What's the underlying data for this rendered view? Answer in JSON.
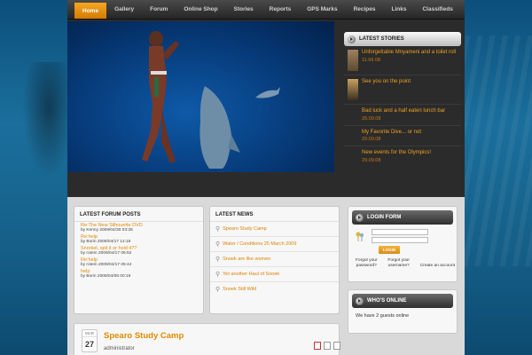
{
  "nav": {
    "items": [
      "Home",
      "Gallery",
      "Forum",
      "Online Shop",
      "Stories",
      "Reports",
      "GPS Marks",
      "Recipes",
      "Links",
      "Classifieds"
    ]
  },
  "latest_stories": {
    "title": "LATEST STORIES",
    "items": [
      {
        "title": "Unforgettable Mnyameni and a toilet roll",
        "date": "11.09.08"
      },
      {
        "title": "See you on the point",
        "date": "25.09.08"
      },
      {
        "title": "Bad luck and a half eaten lunch bar",
        "date": "29.09.08"
      },
      {
        "title": "My Favorite Dive... or not",
        "date": "29.09.08"
      },
      {
        "title": "New events for the Olympics!",
        "date": "29.09.08"
      }
    ]
  },
  "forum_posts": {
    "title": "LATEST FORUM POSTS",
    "items": [
      {
        "title": "Re:The New Silhouette DVD",
        "by": "by Kenny 2009/04/30 03:28"
      },
      {
        "title": "Re:help",
        "by": "by Borin 2009/04/17 14:18"
      },
      {
        "title": "Snorkel, spit it or hold it??",
        "by": "by rotem 2009/04/17 06:52"
      },
      {
        "title": "Re:help",
        "by": "by rotem 2009/04/17 05:44"
      },
      {
        "title": "help",
        "by": "by Borin 2009/04/08 00:19"
      }
    ]
  },
  "latest_news": {
    "title": "LATEST NEWS",
    "items": [
      "Spearo Study Camp",
      "Water / Conditions 25 March 2009",
      "Snoek are like women",
      "Yet another Haul of Snoek",
      "Snoek Still Wild"
    ]
  },
  "login": {
    "title": "LOGIN FORM",
    "button": "LOGIN",
    "forgot_password": [
      "Forgot your",
      "password?"
    ],
    "forgot_username": [
      "Forgot your",
      "username?"
    ],
    "create_account": "Create an account"
  },
  "whos_online": {
    "title": "WHO'S ONLINE",
    "text": "We have 2 guests online"
  },
  "article": {
    "month": "MAR",
    "day": "27",
    "title": "Spearo Study Camp",
    "author": "administrator"
  },
  "colors": {
    "accent": "#f0a020",
    "nav_active": "#e08a00"
  }
}
